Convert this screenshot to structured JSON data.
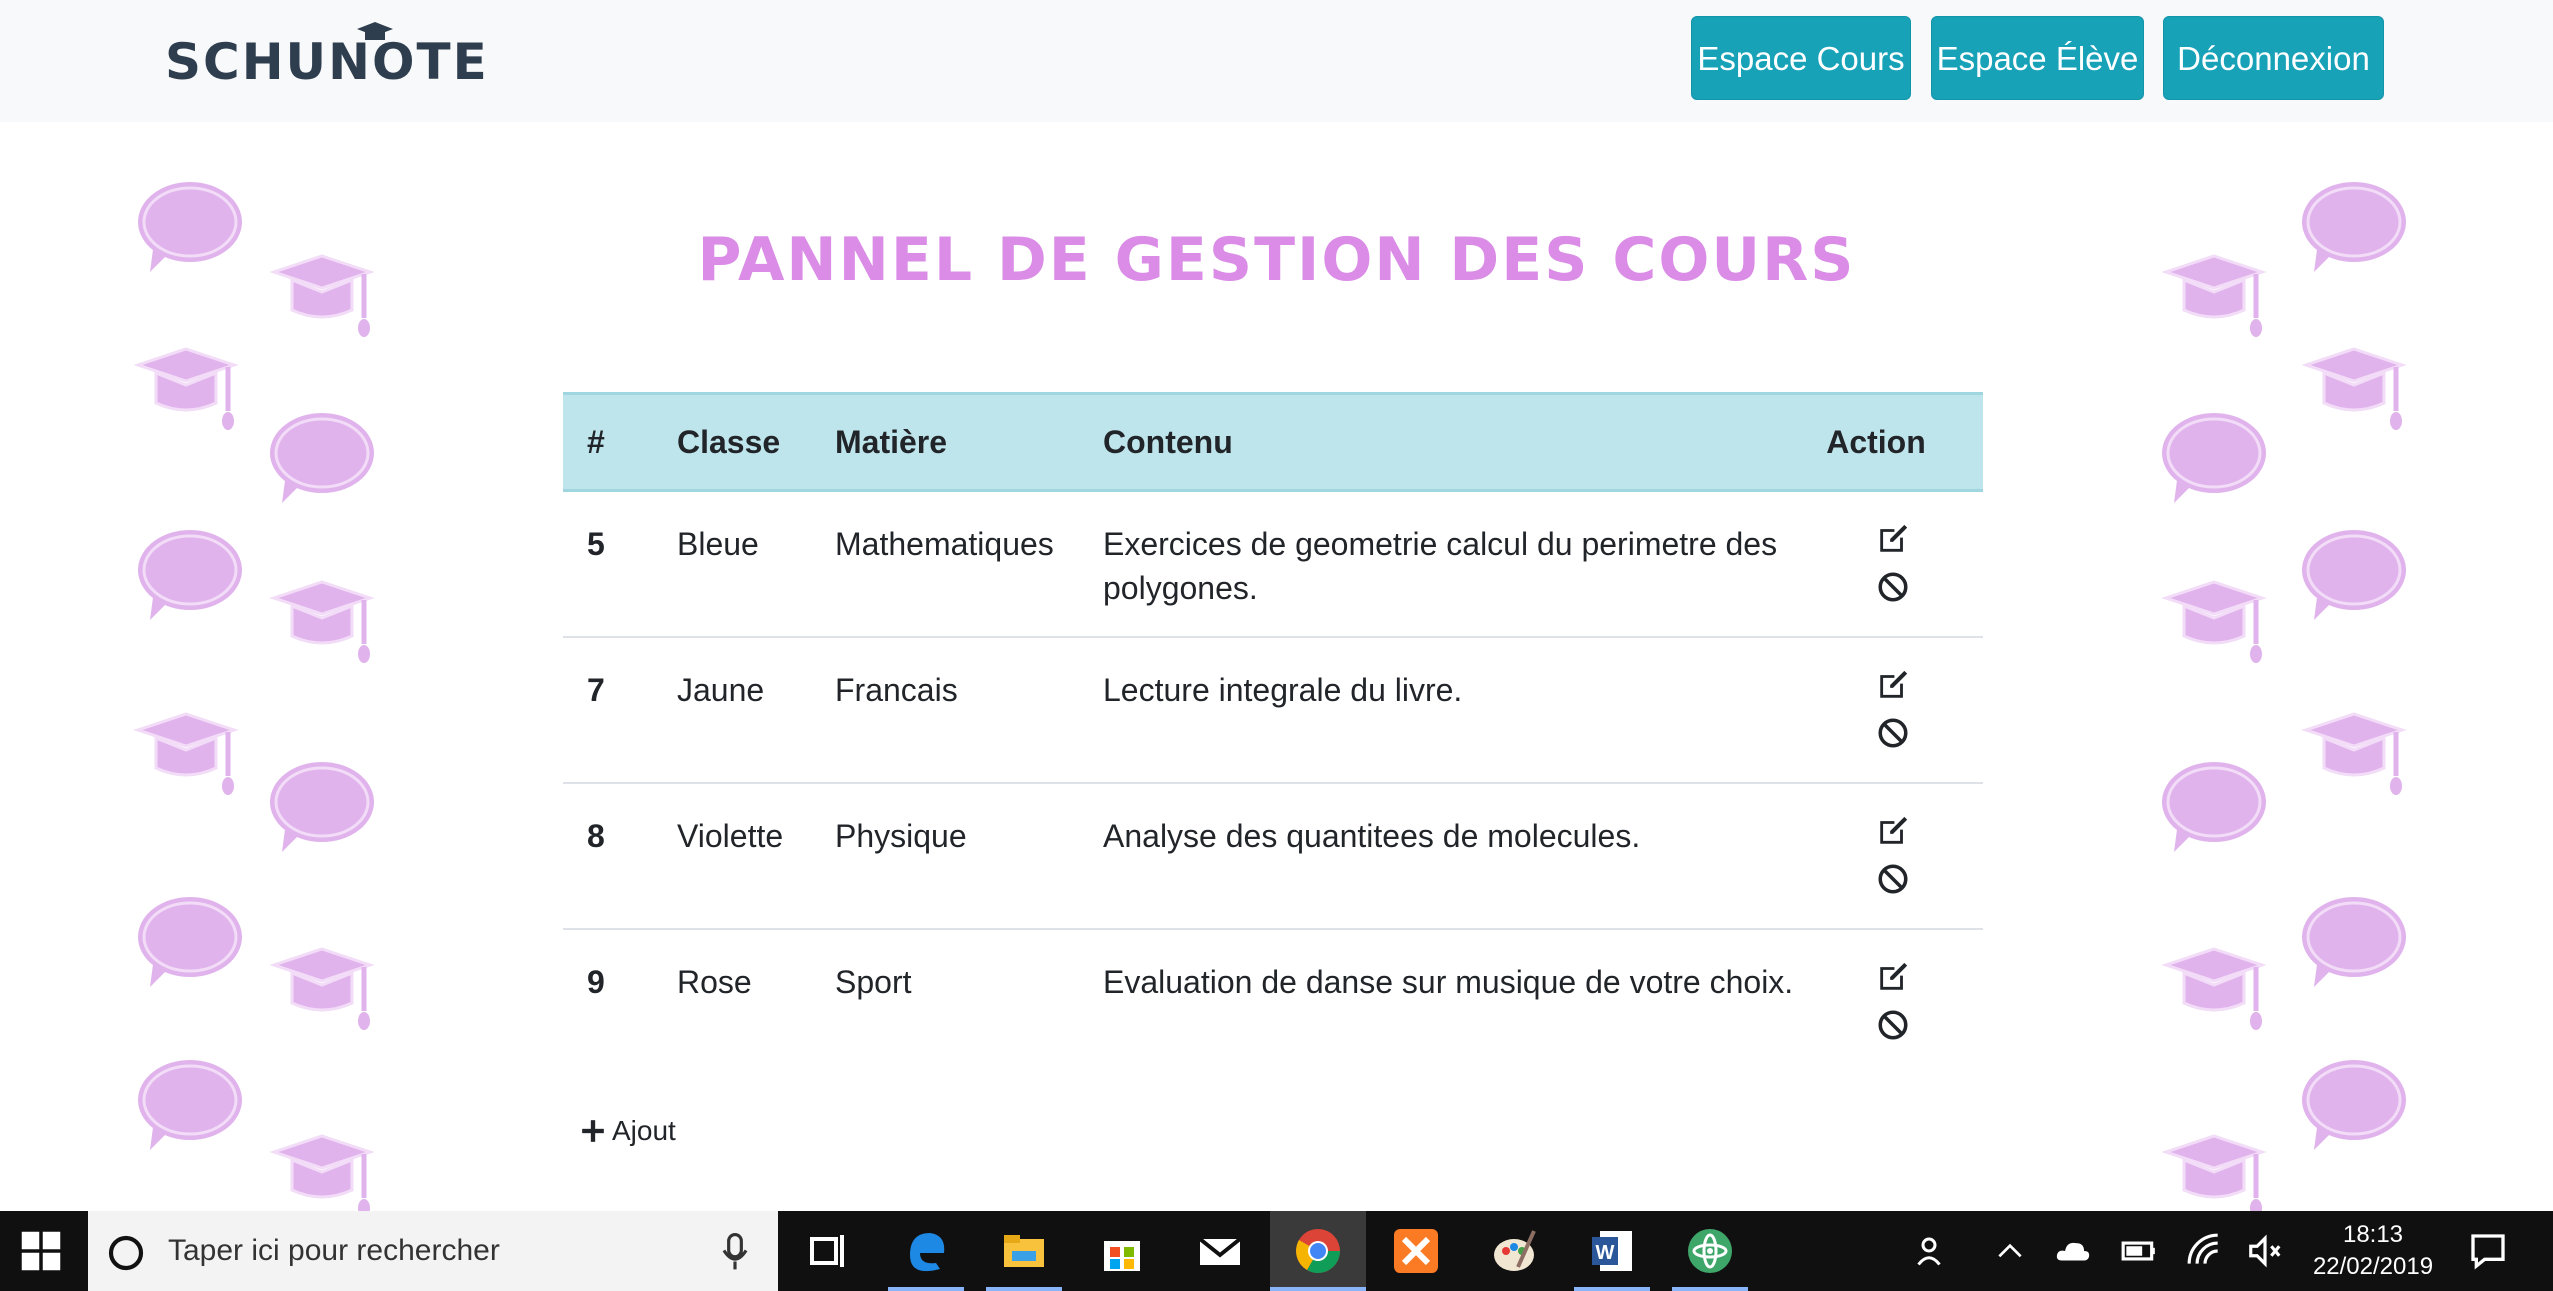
{
  "navbar": {
    "brand": "SCHUNOTE",
    "buttons": [
      {
        "label": "Espace Cours"
      },
      {
        "label": "Espace Élève"
      },
      {
        "label": "Déconnexion"
      }
    ],
    "button_color": "#17a2b8"
  },
  "page_title": "PANNEL DE GESTION DES COURS",
  "title_color": "#da8ce6",
  "table": {
    "headers": [
      "#",
      "Classe",
      "Matière",
      "Contenu",
      "Action"
    ],
    "header_bg": "#bee5eb",
    "rows": [
      {
        "id": "5",
        "classe": "Bleue",
        "matiere": "Mathematiques",
        "contenu": "Exercices de geometrie calcul du perimetre des polygones."
      },
      {
        "id": "7",
        "classe": "Jaune",
        "matiere": "Francais",
        "contenu": "Lecture integrale du livre."
      },
      {
        "id": "8",
        "classe": "Violette",
        "matiere": "Physique",
        "contenu": "Analyse des quantitees de molecules."
      },
      {
        "id": "9",
        "classe": "Rose",
        "matiere": "Sport",
        "contenu": "Evaluation de danse sur musique de votre choix."
      }
    ],
    "action_icons": [
      "edit-icon",
      "ban-icon"
    ]
  },
  "add_link": {
    "label": "Ajout",
    "icon": "plus-icon"
  },
  "taskbar": {
    "search_placeholder": "Taper ici pour rechercher",
    "time": "18:13",
    "date": "22/02/2019",
    "apps": [
      "task-view-icon",
      "edge-icon",
      "file-explorer-icon",
      "store-icon",
      "mail-icon",
      "chrome-icon",
      "xampp-icon",
      "paint-icon",
      "word-icon",
      "atom-icon"
    ],
    "tray": [
      "people-icon",
      "chevron-up-icon",
      "onedrive-icon",
      "battery-icon",
      "wifi-icon",
      "volume-muted-icon",
      "notification-icon"
    ]
  }
}
